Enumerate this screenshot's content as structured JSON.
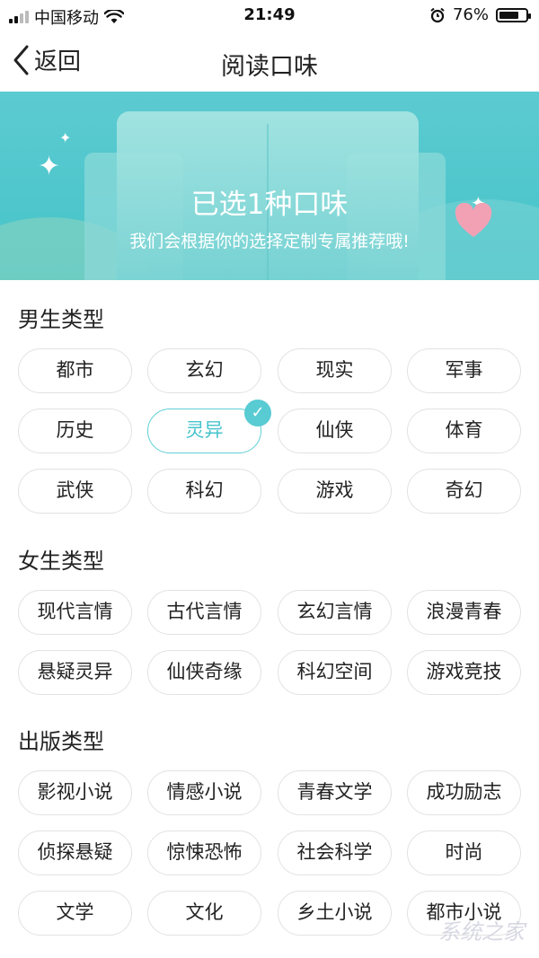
{
  "status_bar": {
    "carrier": "中国移动",
    "time": "21:49",
    "battery": "76%",
    "battery_level": 0.76
  },
  "nav": {
    "back_label": "返回",
    "title": "阅读口味"
  },
  "banner": {
    "heading": "已选1种口味",
    "subtitle": "我们会根据你的选择定制专属推荐哦!"
  },
  "sections": [
    {
      "title": "男生类型",
      "tags": [
        "都市",
        "玄幻",
        "现实",
        "军事",
        "历史",
        "灵异",
        "仙侠",
        "体育",
        "武侠",
        "科幻",
        "游戏",
        "奇幻"
      ]
    },
    {
      "title": "女生类型",
      "tags": [
        "现代言情",
        "古代言情",
        "玄幻言情",
        "浪漫青春",
        "悬疑灵异",
        "仙侠奇缘",
        "科幻空间",
        "游戏竞技"
      ]
    },
    {
      "title": "出版类型",
      "tags": [
        "影视小说",
        "情感小说",
        "青春文学",
        "成功励志",
        "侦探悬疑",
        "惊悚恐怖",
        "社会科学",
        "时尚",
        "文学",
        "文化",
        "乡土小说",
        "都市小说"
      ]
    }
  ],
  "selected_tag": "灵异",
  "colors": {
    "accent": "#46c3cc",
    "banner": "#4fc6cc",
    "tag_border": "#e2e2e2"
  },
  "watermark": "系统之家"
}
